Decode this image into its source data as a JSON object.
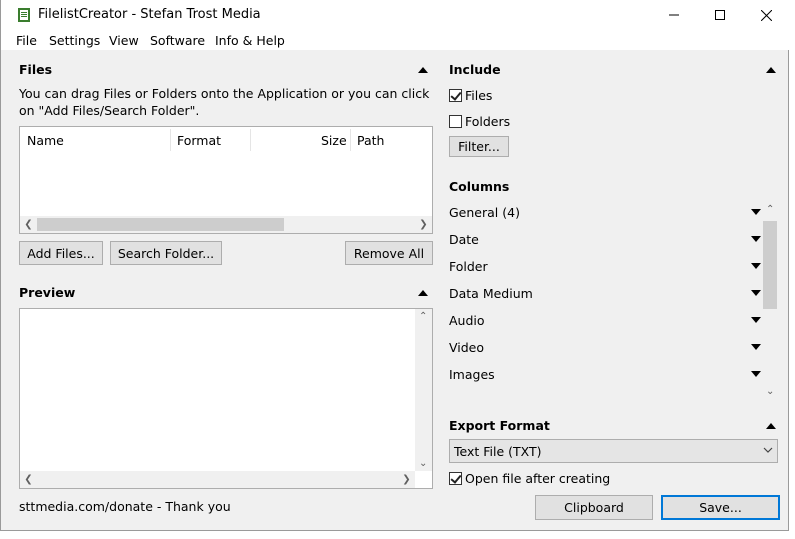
{
  "window": {
    "title": "FilelistCreator - Stefan Trost Media"
  },
  "menu": [
    "File",
    "Settings",
    "View",
    "Software",
    "Info & Help"
  ],
  "files": {
    "title": "Files",
    "hint": "You can drag Files or Folders onto the Application or you can click on \"Add Files/Search Folder\".",
    "columns": [
      "Name",
      "Format",
      "Size",
      "Path"
    ],
    "buttons": {
      "add_files": "Add Files...",
      "search_folder": "Search Folder...",
      "remove_all": "Remove All"
    }
  },
  "preview": {
    "title": "Preview"
  },
  "include": {
    "title": "Include",
    "files": {
      "label": "Files",
      "checked": true
    },
    "folders": {
      "label": "Folders",
      "checked": false
    },
    "filter_button": "Filter..."
  },
  "columns_panel": {
    "title": "Columns",
    "items": [
      "General (4)",
      "Date",
      "Folder",
      "Data Medium",
      "Audio",
      "Video",
      "Images"
    ]
  },
  "export": {
    "title": "Export Format",
    "selected": "Text File (TXT)",
    "open_after": {
      "label": "Open file after creating",
      "checked": true
    }
  },
  "footer": {
    "donate": "sttmedia.com/donate - Thank you",
    "clipboard": "Clipboard",
    "save": "Save..."
  },
  "colors": {
    "accent": "#0078d7",
    "app_icon": "#3a7d2e"
  }
}
